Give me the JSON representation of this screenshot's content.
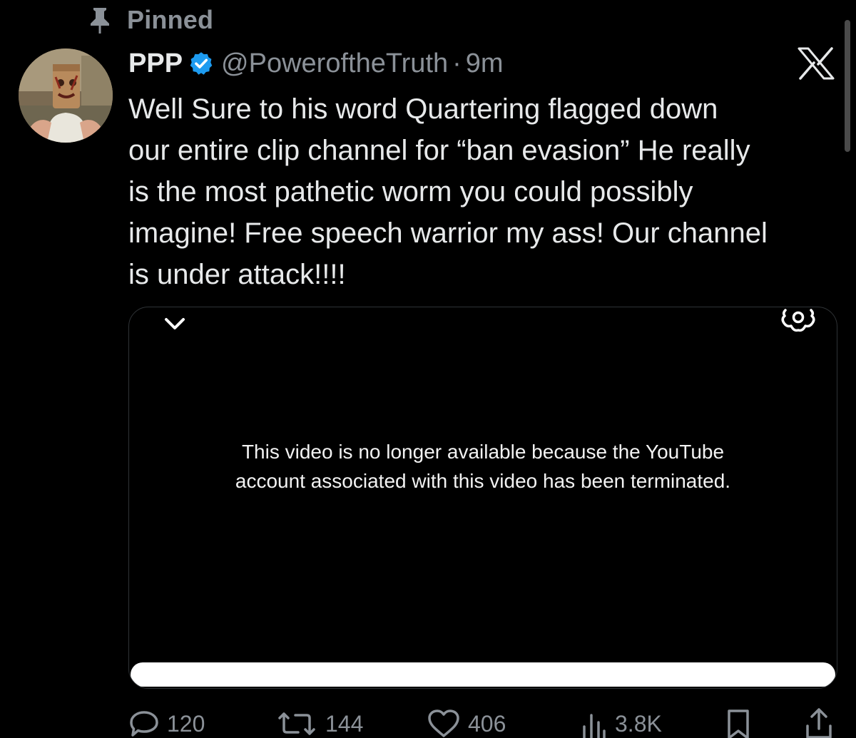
{
  "pinned": {
    "label": "Pinned",
    "icon": "pin-icon"
  },
  "author": {
    "display_name": "PPP",
    "verified": true,
    "handle": "@PoweroftheTruth",
    "separator": "·",
    "time": "9m"
  },
  "tweet": {
    "text": "Well Sure to his word Quartering flagged down\nour entire clip channel for “ban evasion” He really\nis the most pathetic worm you could possibly\nimagine! Free speech warrior my ass! Our channel\nis under attack!!!!"
  },
  "video": {
    "message": "This video is no longer available because the YouTube\naccount associated with this video has been terminated.",
    "progress": 1.0
  },
  "actions": {
    "replies": "120",
    "reposts": "144",
    "likes": "406",
    "views": "3.8K"
  },
  "colors": {
    "background": "#000000",
    "text": "#e7e9ea",
    "secondary": "#8b9198",
    "verified_blue": "#1d9bf0",
    "card_border": "#2f3336"
  },
  "icons": [
    "pin-icon",
    "verified-badge-icon",
    "x-logo-icon",
    "chevron-down-icon",
    "settings-icon",
    "reply-icon",
    "repost-icon",
    "like-icon",
    "views-icon",
    "bookmark-icon",
    "share-icon"
  ]
}
